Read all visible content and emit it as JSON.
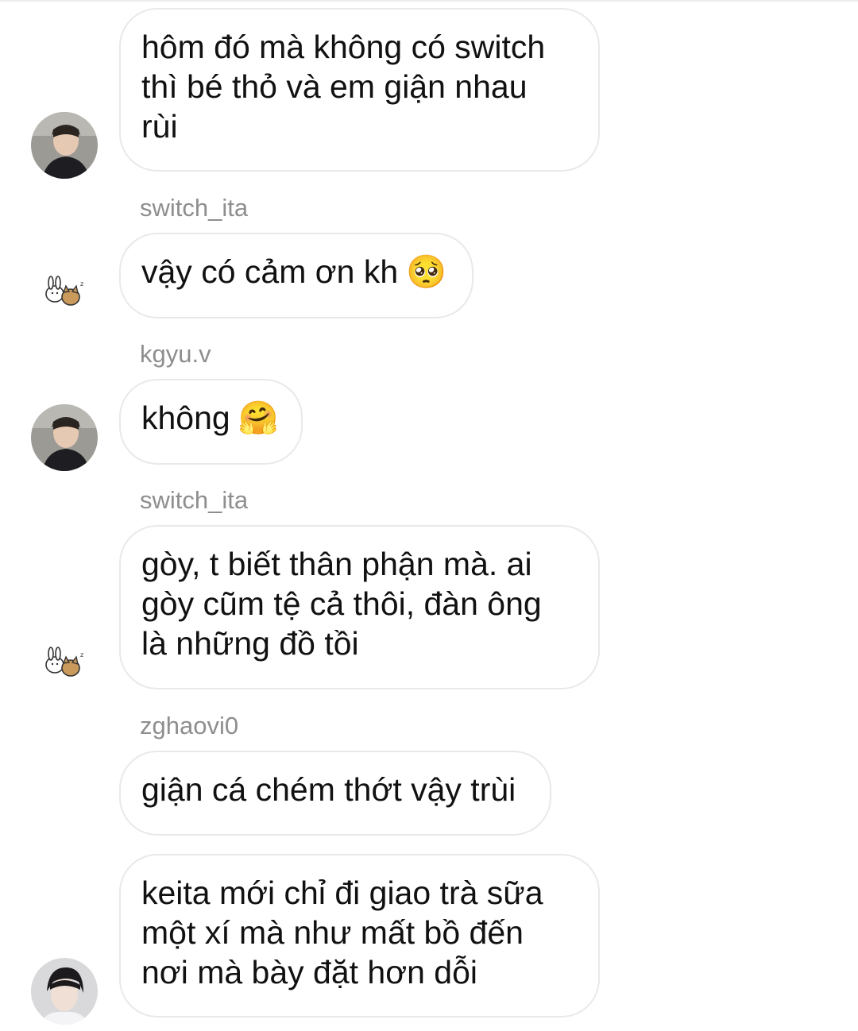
{
  "conversation": {
    "messages": [
      {
        "lines": [
          "hôm đó mà không có switch",
          "thì bé thỏ và em giận nhau",
          "rùi"
        ],
        "emoji": ""
      },
      {
        "lines": [
          "vậy có cảm ơn kh"
        ],
        "emoji": "🥺"
      },
      {
        "lines": [
          "không"
        ],
        "emoji": "🤗"
      },
      {
        "lines": [
          "gòy, t biết thân phận mà. ai",
          "gòy cũm tệ cả thôi, đàn ông",
          "là những đồ tồi"
        ],
        "emoji": ""
      },
      {
        "lines": [
          "giận cá chém thớt vậy trùi"
        ],
        "emoji": ""
      },
      {
        "lines": [
          "keita mới chỉ đi giao trà sữa",
          "một xí mà như mất bồ đến",
          "nơi mà bày đặt hơn dỗi"
        ],
        "emoji": ""
      }
    ],
    "usernames": [
      "switch_ita",
      "kgyu.v",
      "switch_ita",
      "zghaovi0"
    ]
  },
  "colors": {
    "bubble_border": "#e9e9e9",
    "username": "#8e8e8e",
    "text": "#111111"
  }
}
